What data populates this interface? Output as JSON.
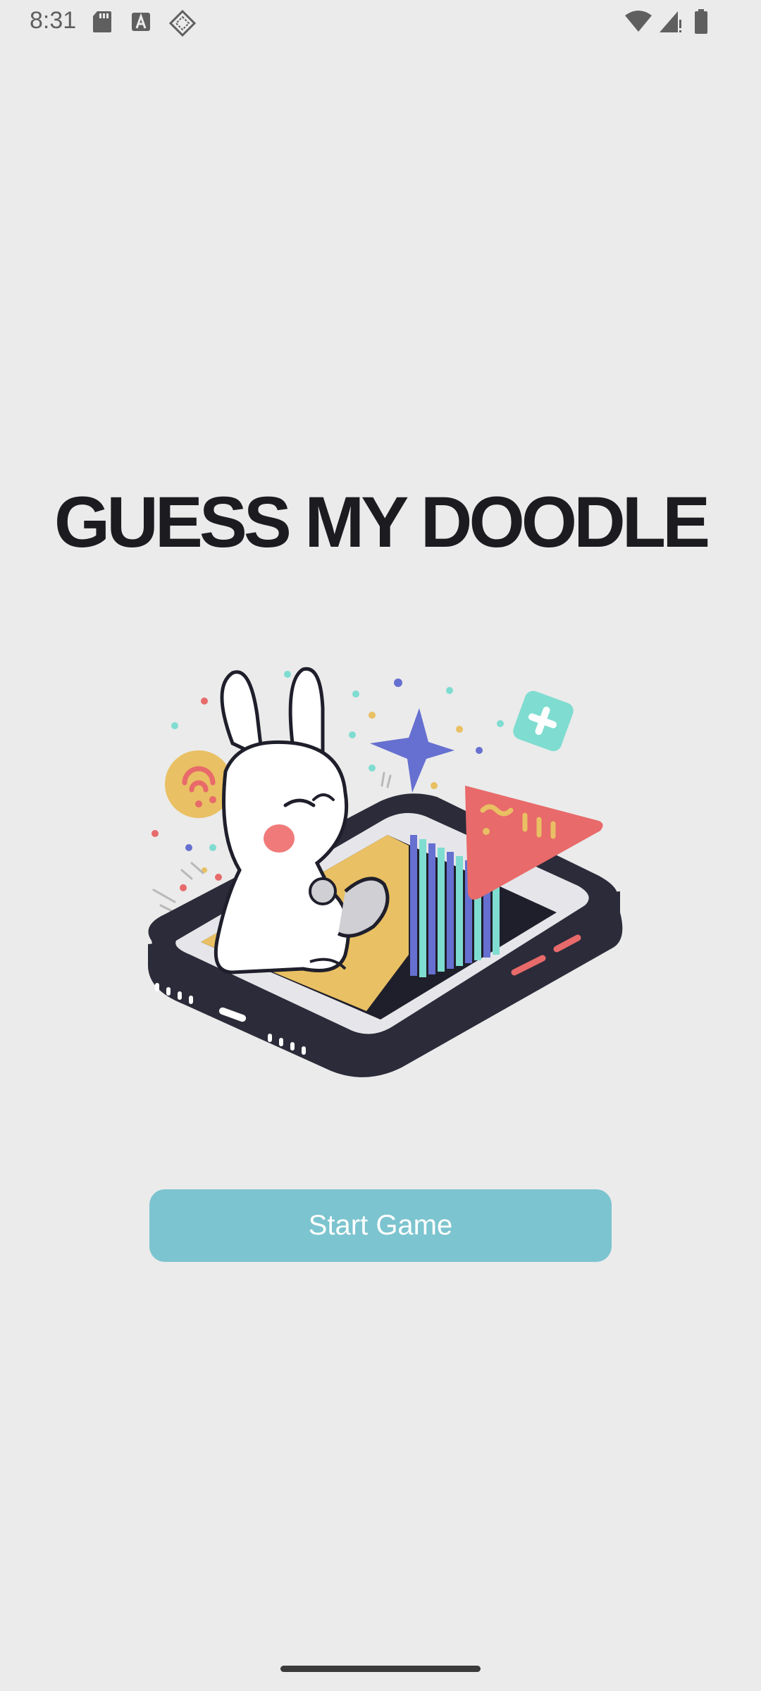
{
  "status_bar": {
    "time": "8:31",
    "icons_left": [
      "sd-card-icon",
      "font-a-icon",
      "location-diamond-icon"
    ],
    "icons_right": [
      "wifi-icon",
      "cell-signal-icon",
      "battery-icon"
    ]
  },
  "main": {
    "title": "GUESS MY DOODLE",
    "illustration": "bunny-in-phone-doodle",
    "start_button_label": "Start Game"
  },
  "colors": {
    "background": "#ebebeb",
    "button": "#7cc4cf",
    "title_text": "#1c1c20"
  }
}
